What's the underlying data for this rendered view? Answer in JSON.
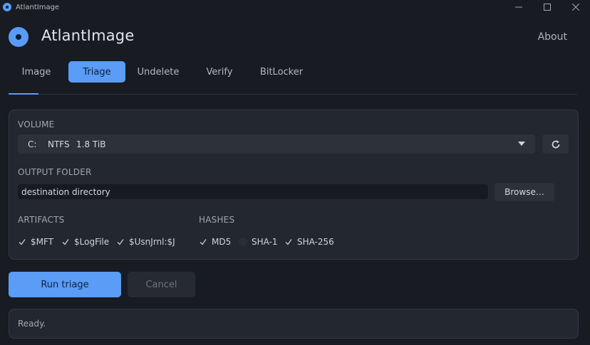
{
  "window": {
    "title": "AtlantImage",
    "controls": [
      "minimize-icon",
      "maximize-icon",
      "close-icon"
    ]
  },
  "header": {
    "app_name": "AtlantImage",
    "about": "About"
  },
  "tabs": [
    {
      "label": "Image",
      "active": false
    },
    {
      "label": "Triage",
      "active": true
    },
    {
      "label": "Undelete",
      "active": false
    },
    {
      "label": "Verify",
      "active": false
    },
    {
      "label": "BitLocker",
      "active": false
    }
  ],
  "volume": {
    "label": "VOLUME",
    "drive": "C:",
    "filesystem": "NTFS",
    "size": "1.8 TiB"
  },
  "output": {
    "label": "OUTPUT FOLDER",
    "value": "destination directory",
    "browse": "Browse…"
  },
  "artifacts": {
    "label": "ARTIFACTS",
    "items": [
      {
        "label": "$MFT",
        "checked": true
      },
      {
        "label": "$LogFile",
        "checked": true
      },
      {
        "label": "$UsnJrnl:$J",
        "checked": true
      }
    ]
  },
  "hashes": {
    "label": "HASHES",
    "items": [
      {
        "label": "MD5",
        "checked": true
      },
      {
        "label": "SHA-1",
        "checked": false
      },
      {
        "label": "SHA-256",
        "checked": true
      }
    ]
  },
  "actions": {
    "run": "Run triage",
    "cancel": "Cancel"
  },
  "status": {
    "text": "Ready."
  },
  "colors": {
    "accent": "#5a9cf6",
    "background": "#181b22",
    "panel": "#232730"
  }
}
